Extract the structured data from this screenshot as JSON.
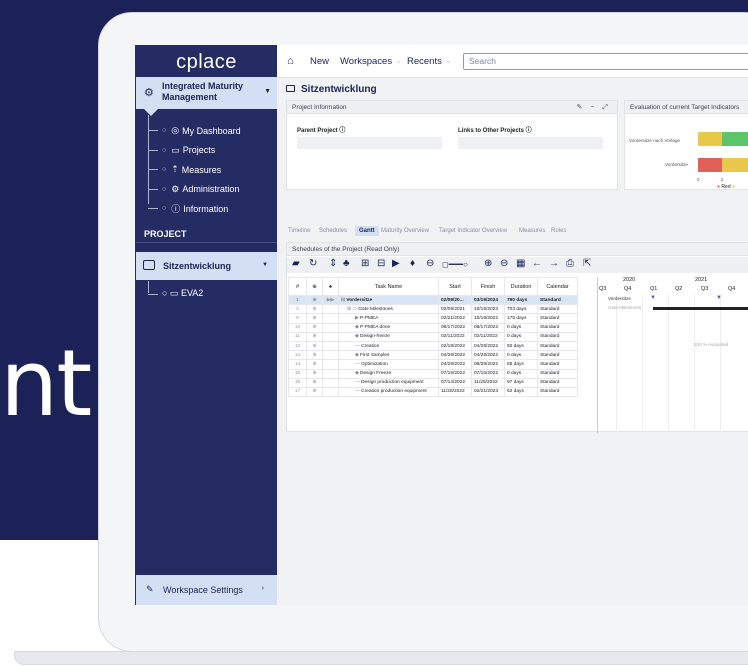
{
  "background": {
    "headline_fragment": "nt",
    "colors": {
      "navy": "#1c2257",
      "accent": "#d3e0f4"
    }
  },
  "sidebar": {
    "logo": "cplace",
    "workspace": "Integrated Maturity Management",
    "items": [
      {
        "label": "My Dashboard",
        "icon": "user-circle-icon"
      },
      {
        "label": "Projects",
        "icon": "folder-icon"
      },
      {
        "label": "Measures",
        "icon": "measure-icon"
      },
      {
        "label": "Administration",
        "icon": "gear-icon"
      },
      {
        "label": "Information",
        "icon": "info-icon"
      }
    ],
    "project_header": "PROJECT",
    "project": "Sitzentwicklung",
    "sub_item": "EVA2",
    "workspace_settings": "Workspace Settings"
  },
  "topbar": {
    "new": "New",
    "workspaces": "Workspaces",
    "recents": "Recents",
    "search_placeholder": "Search"
  },
  "page": {
    "title": "Sitzentwicklung"
  },
  "project_info": {
    "header": "Project Information",
    "parent_label": "Parent Project",
    "links_label": "Links to Other Projects"
  },
  "evaluation": {
    "header": "Evaluation of current Target Indicators",
    "categories": [
      "Vordersitze nach Vorlage",
      "Vordersitze"
    ],
    "axis_ticks": [
      "0",
      "2"
    ],
    "legend": [
      "Red"
    ]
  },
  "tabs": [
    "Timeline",
    "Schedules",
    "Gantt",
    "Maturity Overview",
    "Target Indicator Overview",
    "Measures",
    "Roles"
  ],
  "active_tab": "Gantt",
  "schedule": {
    "header": "Schedules of the Project (Read Only)",
    "columns": [
      "#",
      "Task Name",
      "Start",
      "Finish",
      "Duration",
      "Calendar"
    ],
    "rows": [
      {
        "n": "1",
        "name": "Vordersitze",
        "start": "02/09/20...",
        "finish": "03/19/2024",
        "duration": "790 days",
        "calendar": "Standard"
      },
      {
        "n": "2",
        "name": "Gate Milestones",
        "start": "02/09/2021",
        "finish": "10/19/2023",
        "duration": "703 days",
        "calendar": "Standard"
      },
      {
        "n": "9",
        "name": "P-PMEA",
        "start": "02/21/2022",
        "finish": "10/19/2022",
        "duration": "175 days",
        "calendar": "Standard"
      },
      {
        "n": "10",
        "name": "P-PMEA done",
        "start": "08/17/2022",
        "finish": "08/17/2022",
        "duration": "0 days",
        "calendar": "Standard"
      },
      {
        "n": "11",
        "name": "Design-freeze",
        "start": "02/11/2022",
        "finish": "02/11/2022",
        "duration": "0 days",
        "calendar": "Standard"
      },
      {
        "n": "12",
        "name": "Creation",
        "start": "02/18/2022",
        "finish": "04/28/2022",
        "duration": "50 days",
        "calendar": "Standard"
      },
      {
        "n": "13",
        "name": "First Samples",
        "start": "04/28/2022",
        "finish": "04/28/2022",
        "duration": "0 days",
        "calendar": "Standard"
      },
      {
        "n": "14",
        "name": "Optimization",
        "start": "04/29/2022",
        "finish": "08/29/2022",
        "duration": "85 days",
        "calendar": "Standard"
      },
      {
        "n": "15",
        "name": "Design Freeze",
        "start": "07/15/2022",
        "finish": "07/15/2022",
        "duration": "0 days",
        "calendar": "Standard"
      },
      {
        "n": "16",
        "name": "Design production equipment",
        "start": "07/14/2022",
        "finish": "11/25/2022",
        "duration": "97 days",
        "calendar": "Standard"
      },
      {
        "n": "17",
        "name": "Creation production equipment",
        "start": "11/28/2022",
        "finish": "02/21/2023",
        "duration": "62 days",
        "calendar": "Standard"
      }
    ],
    "years": [
      "2020",
      "2021"
    ],
    "quarters": [
      "Q3",
      "Q4",
      "Q1",
      "Q2",
      "Q3",
      "Q4"
    ],
    "bar_labels": [
      "Vordersitze",
      "Gate Milestones",
      "100 % evaluated"
    ]
  }
}
